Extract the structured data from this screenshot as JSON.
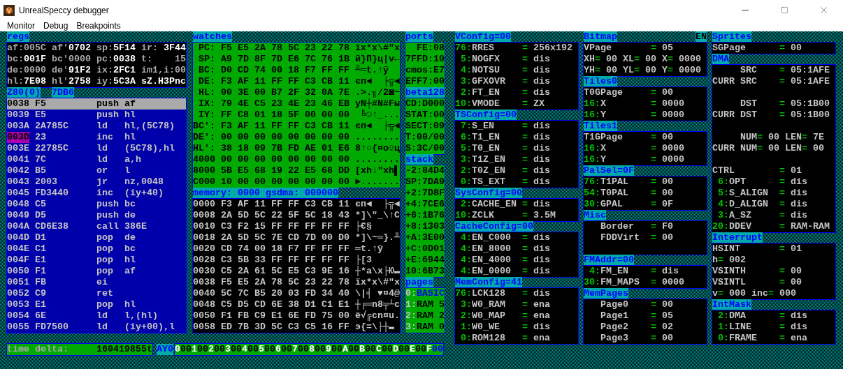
{
  "window": {
    "title": "UnrealSpeccy debugger"
  },
  "menu": [
    "Monitor",
    "Debug",
    "Breakpoints"
  ],
  "regs": {
    "title": "regs",
    "rows": [
      {
        "cells": [
          {
            "name": "af:",
            "value": "005C",
            "bright": false
          },
          {
            "name": "af'",
            "value": "0702",
            "bright": true
          },
          {
            "name": "sp:",
            "value": "5F14",
            "bright": true
          },
          {
            "name": "ir:",
            "value": "3F44",
            "bright": true
          }
        ]
      },
      {
        "cells": [
          {
            "name": "bc:",
            "value": "001F",
            "bright": true
          },
          {
            "name": "bc'",
            "value": "0000",
            "bright": false
          },
          {
            "name": "pc:",
            "value": "0038",
            "bright": true
          },
          {
            "name": "t:",
            "value": "15",
            "bright": false
          }
        ]
      },
      {
        "cells": [
          {
            "name": "de:",
            "value": "0000",
            "bright": false
          },
          {
            "name": "de'",
            "value": "91F2",
            "bright": true
          },
          {
            "name": "ix:",
            "value": "2FC1",
            "bright": true
          },
          {
            "name": "im1,i:",
            "value": "00",
            "bright": false
          }
        ]
      },
      {
        "cells": [
          {
            "name": "hl:",
            "value": "7E08",
            "bright": true
          },
          {
            "name": "hl'",
            "value": "2758",
            "bright": true
          },
          {
            "name": "iy:",
            "value": "5C3A",
            "bright": true
          },
          {
            "value": "sZ.H3Pnc",
            "bright": true
          }
        ]
      }
    ]
  },
  "disasm": {
    "cpu": "Z80(0)",
    "address": "7DB6",
    "rows": [
      {
        "addr": "0038",
        "bytes": "F5",
        "op": "push",
        "args": "af",
        "selected": true,
        "breakpoint": false
      },
      {
        "addr": "0039",
        "bytes": "E5",
        "op": "push",
        "args": "hl",
        "selected": false,
        "breakpoint": false
      },
      {
        "addr": "003A",
        "bytes": "2A785C",
        "op": "ld",
        "args": "hl,(5C78)",
        "selected": false,
        "breakpoint": false
      },
      {
        "addr": "003D",
        "bytes": "23",
        "op": "inc",
        "args": "hl",
        "selected": false,
        "breakpoint": true
      },
      {
        "addr": "003E",
        "bytes": "22785C",
        "op": "ld",
        "args": "(5C78),hl",
        "selected": false,
        "breakpoint": false
      },
      {
        "addr": "0041",
        "bytes": "7C",
        "op": "ld",
        "args": "a,h",
        "selected": false,
        "breakpoint": false
      },
      {
        "addr": "0042",
        "bytes": "B5",
        "op": "or",
        "args": "l",
        "selected": false,
        "breakpoint": false
      },
      {
        "addr": "0043",
        "bytes": "2003",
        "op": "jr",
        "args": "nz,0048",
        "selected": false,
        "breakpoint": false
      },
      {
        "addr": "0045",
        "bytes": "FD3440",
        "op": "inc",
        "args": "(iy+40)",
        "selected": false,
        "breakpoint": false
      },
      {
        "addr": "0048",
        "bytes": "C5",
        "op": "push",
        "args": "bc",
        "selected": false,
        "breakpoint": false
      },
      {
        "addr": "0049",
        "bytes": "D5",
        "op": "push",
        "args": "de",
        "selected": false,
        "breakpoint": false
      },
      {
        "addr": "004A",
        "bytes": "CD6E38",
        "op": "call",
        "args": "386E",
        "selected": false,
        "breakpoint": false
      },
      {
        "addr": "004D",
        "bytes": "D1",
        "op": "pop",
        "args": "de",
        "selected": false,
        "breakpoint": false
      },
      {
        "addr": "004E",
        "bytes": "C1",
        "op": "pop",
        "args": "bc",
        "selected": false,
        "breakpoint": false
      },
      {
        "addr": "004F",
        "bytes": "E1",
        "op": "pop",
        "args": "hl",
        "selected": false,
        "breakpoint": false
      },
      {
        "addr": "0050",
        "bytes": "F1",
        "op": "pop",
        "args": "af",
        "selected": false,
        "breakpoint": false
      },
      {
        "addr": "0051",
        "bytes": "FB",
        "op": "ei",
        "selected": false,
        "breakpoint": false
      },
      {
        "addr": "0052",
        "bytes": "C9",
        "op": "ret",
        "selected": false,
        "breakpoint": false
      },
      {
        "addr": "0053",
        "bytes": "E1",
        "op": "pop",
        "args": "hl",
        "selected": false,
        "breakpoint": false
      },
      {
        "addr": "0054",
        "bytes": "6E",
        "op": "ld",
        "args": "l,(hl)",
        "selected": false,
        "breakpoint": false
      },
      {
        "addr": "0055",
        "bytes": "FD7500",
        "op": "ld",
        "args": "(iy+00),l",
        "selected": false,
        "breakpoint": false
      }
    ]
  },
  "watches": {
    "title": "watches",
    "rows": [
      {
        "label": "PC:",
        "bytes": "F5 E5 2A 78 5C 23 22 78",
        "ascii": "їх*x\\#\"x"
      },
      {
        "label": "SP:",
        "bytes": "A9 7D 8F 7D E6 7C 76 1B",
        "ascii": "й}П}ц|v←"
      },
      {
        "label": "BC:",
        "bytes": "D0 CD 74 00 18 F7 FF FF",
        "ascii": "╨═t.↑ў"
      },
      {
        "label": "DE:",
        "bytes": "F3 AF 11 FF FF C3 CB 11",
        "ascii": "єп◄  ├╦◄"
      },
      {
        "label": "HL:",
        "bytes": "00 3E 00 B7 2F 32 0A 7E",
        "ascii": ".>.╖/2◙~"
      },
      {
        "label": "IX:",
        "bytes": "79 4E C5 23 4E 23 46 EB",
        "ascii": "yN┼#N#Fы"
      },
      {
        "label": "IY:",
        "bytes": "FF C8 01 18 5F 00 00 00",
        "ascii": " ╚☺↑_..."
      },
      {
        "label": "BC':",
        "bytes": "F3 AF 11 FF FF C3 CB 11",
        "ascii": "єп◄  ├╦◄"
      },
      {
        "label": "DE':",
        "bytes": "00 00 00 00 00 00 00 00",
        "ascii": "........"
      },
      {
        "label": "HL':",
        "bytes": "38 18 09 7B FD AE 01 E6",
        "ascii": "8↑○{¤о☺ц"
      },
      {
        "label": "4000",
        "bytes": "00 00 00 00 00 00 00 00",
        "ascii": "........"
      },
      {
        "label": "8000",
        "bytes": "5B E5 68 19 22 E5 68 DD",
        "ascii": "[хh↓\"хh▌"
      },
      {
        "label": "C000",
        "bytes": "10 00 00 00 00 00 00 00",
        "ascii": "►......."
      }
    ]
  },
  "memory": {
    "title": "memory: 0000 gsdma: 000000",
    "rows": [
      {
        "label": "0000",
        "bytes": "F3 AF 11 FF FF C3 CB 11",
        "ascii": "єп◄  ├╦◄"
      },
      {
        "label": "0008",
        "bytes": "2A 5D 5C 22 5F 5C 18 43",
        "ascii": "*]\\\"_\\↑C"
      },
      {
        "label": "0010",
        "bytes": "C3 F2 15 FF FF FF FF FF",
        "ascii": "├Є§"
      },
      {
        "label": "0018",
        "bytes": "2A 5D 5C 7E CD 7D 00 D0",
        "ascii": "*]\\~═}.╨"
      },
      {
        "label": "0020",
        "bytes": "CD 74 00 18 F7 FF FF FF",
        "ascii": "═t.↑ў"
      },
      {
        "label": "0028",
        "bytes": "C3 5B 33 FF FF FF FF FF",
        "ascii": "├[3"
      },
      {
        "label": "0030",
        "bytes": "C5 2A 61 5C E5 C3 9E 16",
        "ascii": "┼*a\\х├Ю▬"
      },
      {
        "label": "0038",
        "bytes": "F5 E5 2A 78 5C 23 22 78",
        "ascii": "їх*x\\#\"x"
      },
      {
        "label": "0040",
        "bytes": "5C 7C B5 20 03 FD 34 40",
        "ascii": "\\|╡ ♥¤4@"
      },
      {
        "label": "0048",
        "bytes": "C5 D5 CD 6E 38 D1 C1 E1",
        "ascii": "┼╒═n8╤┴с"
      },
      {
        "label": "0050",
        "bytes": "F1 FB C9 E1 6E FD 75 00",
        "ascii": "ё√╔сn¤u."
      },
      {
        "label": "0058",
        "bytes": "ED 7B 3D 5C C3 C5 16 FF",
        "ascii": "э{=\\├┼▬"
      }
    ]
  },
  "io": [
    {
      "kind": "ports",
      "title": "ports",
      "lines": [
        "FE:08",
        "7FFD:10",
        "cmos:E7",
        "EFF7:00"
      ]
    },
    {
      "kind": "lines",
      "title": "beta128",
      "lines": [
        "CD:D000",
        "STAT:00",
        "SECT:09",
        "T:00/00",
        "S:3C/00"
      ]
    },
    {
      "kind": "lines",
      "title": "stack",
      "lines": [
        "-2:84D4",
        "SP:7DA9",
        "+2:7D8F",
        "+4:7CE6",
        "+6:1B76",
        "+8:1303",
        "+A:3E00",
        "+C:0D01",
        "+E:6944",
        "10:6B73"
      ]
    },
    {
      "kind": "pages",
      "title": "pages",
      "pages": [
        {
          "index": "0:",
          "name": "BASIC",
          "selected": true
        },
        {
          "index": "1:",
          "name": "RAM 5",
          "selected": false
        },
        {
          "index": "2:",
          "name": "RAM 2",
          "selected": false
        },
        {
          "index": "3:",
          "name": "RAM 0",
          "selected": false
        }
      ]
    }
  ],
  "config_columns": [
    {
      "sections": [
        {
          "title": "VConfig=00",
          "rows": [
            {
              "kind": "field",
              "bits": "76:",
              "name": "RRES",
              "eq": "=",
              "value": "256x192"
            },
            {
              "kind": "field",
              "bits": "5:",
              "name": "NOGFX",
              "eq": "=",
              "value": "dis"
            },
            {
              "kind": "field",
              "bits": "4:",
              "name": "NOTSU",
              "eq": "=",
              "value": "dis"
            },
            {
              "kind": "field",
              "bits": "3:",
              "name": "GFXOVR",
              "eq": "=",
              "value": "dis"
            },
            {
              "kind": "field",
              "bits": "2:",
              "name": "FT_EN",
              "eq": "=",
              "value": "dis"
            },
            {
              "kind": "field",
              "bits": "10:",
              "name": "VMODE",
              "eq": "=",
              "value": "ZX"
            }
          ]
        },
        {
          "title": "TSConfig=00",
          "rows": [
            {
              "kind": "field",
              "bits": "7:",
              "name": "S_EN",
              "eq": "=",
              "value": "dis"
            },
            {
              "kind": "field",
              "bits": "6:",
              "name": "T1_EN",
              "eq": "=",
              "value": "dis"
            },
            {
              "kind": "field",
              "bits": "5:",
              "name": "T0_EN",
              "eq": "=",
              "value": "dis"
            },
            {
              "kind": "field",
              "bits": "3:",
              "name": "T1Z_EN",
              "eq": "=",
              "value": "dis"
            },
            {
              "kind": "field",
              "bits": "2:",
              "name": "T0Z_EN",
              "eq": "=",
              "value": "dis"
            },
            {
              "kind": "field",
              "bits": "0:",
              "name": "TS_EXT",
              "eq": "=",
              "value": "dis"
            }
          ]
        },
        {
          "title": "SysConfig=00",
          "rows": [
            {
              "kind": "field",
              "bits": "2:",
              "name": "CACHE_EN",
              "eq": "=",
              "value": "dis"
            },
            {
              "kind": "field",
              "bits": "10:",
              "name": "ZCLK",
              "eq": "=",
              "value": "3.5M"
            }
          ]
        },
        {
          "title": "CacheConfig=00",
          "rows": [
            {
              "kind": "field",
              "bits": "4:",
              "name": "EN_C000",
              "eq": "=",
              "value": "dis"
            },
            {
              "kind": "field",
              "bits": "4:",
              "name": "EN_8000",
              "eq": "=",
              "value": "dis"
            },
            {
              "kind": "field",
              "bits": "4:",
              "name": "EN_4000",
              "eq": "=",
              "value": "dis"
            },
            {
              "kind": "field",
              "bits": "4:",
              "name": "EN_0000",
              "eq": "=",
              "value": "dis"
            }
          ]
        },
        {
          "title": "MemConfig=41",
          "rows": [
            {
              "kind": "field",
              "bits": "76:",
              "name": "LCK128",
              "eq": "=",
              "value": "dis"
            },
            {
              "kind": "field",
              "bits": "3:",
              "name": "W0_RAM",
              "eq": "=",
              "value": "ena"
            },
            {
              "kind": "field",
              "bits": "2:",
              "name": "W0_MAP",
              "eq": "=",
              "value": "ena"
            },
            {
              "kind": "field",
              "bits": "1:",
              "name": "W0_WE",
              "eq": "=",
              "value": "dis"
            },
            {
              "kind": "field",
              "bits": "0:",
              "name": "ROM128",
              "eq": "=",
              "value": "ena"
            }
          ]
        }
      ]
    },
    {
      "sections": [
        {
          "title": "Bitmap",
          "badge": "EN",
          "rows": [
            {
              "kind": "field",
              "name": "VPage",
              "eq": "=",
              "value": "05"
            },
            {
              "kind": "pairs",
              "items": [
                {
                  "name": "XH",
                  "eq": "=",
                  "value": "00"
                },
                {
                  "name": "XL",
                  "eq": "=",
                  "value": "00"
                },
                {
                  "name": "X",
                  "eq": "=",
                  "value": "0000"
                }
              ]
            },
            {
              "kind": "pairs",
              "items": [
                {
                  "name": "YH",
                  "eq": "=",
                  "value": "00"
                },
                {
                  "name": "YL",
                  "eq": "=",
                  "value": "00"
                },
                {
                  "name": "Y",
                  "eq": "=",
                  "value": "0000"
                }
              ]
            }
          ]
        },
        {
          "title": "Tiles0",
          "rows": [
            {
              "kind": "field",
              "name": "T0GPage",
              "eq": "=",
              "value": "00"
            },
            {
              "kind": "field",
              "bits": "16:",
              "name": "X",
              "eq": "=",
              "value": "0000"
            },
            {
              "kind": "field",
              "bits": "16:",
              "name": "Y",
              "eq": "=",
              "value": "0000"
            }
          ]
        },
        {
          "title": "Tiles1",
          "rows": [
            {
              "kind": "field",
              "name": "T1GPage",
              "eq": "=",
              "value": "00"
            },
            {
              "kind": "field",
              "bits": "16:",
              "name": "X",
              "eq": "=",
              "value": "0000"
            },
            {
              "kind": "field",
              "bits": "16:",
              "name": "Y",
              "eq": "=",
              "value": "0000"
            }
          ]
        },
        {
          "title": "PalSel=0F",
          "rows": [
            {
              "kind": "field",
              "bits": "76:",
              "name": "T1PAL",
              "eq": "=",
              "value": "00"
            },
            {
              "kind": "field",
              "bits": "54:",
              "name": "T0PAL",
              "eq": "=",
              "value": "00"
            },
            {
              "kind": "field",
              "bits": "30:",
              "name": "GPAL",
              "eq": "=",
              "value": "0F"
            }
          ]
        },
        {
          "title": "Misc",
          "rows": [
            {
              "kind": "indented",
              "name": "Border",
              "eq": "=",
              "value": "F0"
            },
            {
              "kind": "indented",
              "name": "FDDVirt",
              "eq": "=",
              "value": "00"
            },
            {
              "kind": "blank"
            }
          ]
        },
        {
          "title": "FMAddr=00",
          "rows": [
            {
              "kind": "field",
              "bits": "4:",
              "name": "FM_EN",
              "eq": "=",
              "value": "dis"
            },
            {
              "kind": "field",
              "bits": "30:",
              "name": "FM_MAPS",
              "eq": "=",
              "value": "0000"
            }
          ]
        },
        {
          "title": "MemPages",
          "rows": [
            {
              "kind": "indented",
              "name": "Page0",
              "eq": "=",
              "value": "00"
            },
            {
              "kind": "indented",
              "name": "Page1",
              "eq": "=",
              "value": "05"
            },
            {
              "kind": "indented",
              "name": "Page2",
              "eq": "=",
              "value": "02"
            },
            {
              "kind": "indented",
              "name": "Page3",
              "eq": "=",
              "value": "00"
            }
          ]
        }
      ]
    },
    {
      "sections": [
        {
          "title": "Sprites",
          "rows": [
            {
              "kind": "field",
              "name": "SGPage",
              "eq": "=",
              "value": "00"
            }
          ]
        },
        {
          "title": "DMA",
          "rows": [
            {
              "kind": "aligned",
              "name": "SRC",
              "eq": "=",
              "value": "05:1AFE"
            },
            {
              "kind": "aligned",
              "prefix": "CURR",
              "name": "SRC",
              "eq": "=",
              "value": "05:1AFE"
            },
            {
              "kind": "blank"
            },
            {
              "kind": "aligned",
              "name": "DST",
              "eq": "=",
              "value": "05:1B00"
            },
            {
              "kind": "aligned",
              "prefix": "CURR",
              "name": "DST",
              "eq": "=",
              "value": "05:1B00"
            },
            {
              "kind": "blank"
            },
            {
              "kind": "aligned_pairs",
              "items": [
                {
                  "name": "NUM",
                  "eq": "=",
                  "value": "00"
                },
                {
                  "name": "LEN",
                  "eq": "=",
                  "value": "7E"
                }
              ]
            },
            {
              "kind": "aligned_pairs",
              "prefix": "CURR",
              "items": [
                {
                  "name": "NUM",
                  "eq": "=",
                  "value": "00"
                },
                {
                  "name": "LEN",
                  "eq": "=",
                  "value": "00"
                }
              ]
            },
            {
              "kind": "blank"
            },
            {
              "kind": "field",
              "name": "CTRL",
              "eq": "=",
              "value": "01"
            },
            {
              "kind": "field",
              "bits": "6:",
              "name": "OPT",
              "eq": "=",
              "value": "dis"
            },
            {
              "kind": "field",
              "bits": "5:",
              "name": "S_ALIGN",
              "eq": "=",
              "value": "dis"
            },
            {
              "kind": "field",
              "bits": "4:",
              "name": "D_ALIGN",
              "eq": "=",
              "value": "dis"
            },
            {
              "kind": "field",
              "bits": "3:",
              "name": "A_SZ",
              "eq": "=",
              "value": "dis"
            },
            {
              "kind": "field",
              "bits": "20:",
              "name": "DDEV",
              "eq": "=",
              "value": "RAM-RAM"
            }
          ]
        },
        {
          "title": "Interrupt",
          "rows": [
            {
              "kind": "field",
              "name": "HSINT",
              "eq": "=",
              "value": "01"
            },
            {
              "kind": "pairs",
              "items": [
                {
                  "name": "h",
                  "eq": "=",
                  "value": "002"
                }
              ]
            },
            {
              "kind": "field",
              "name": "VSINTH",
              "eq": "=",
              "value": "00"
            },
            {
              "kind": "field",
              "name": "VSINTL",
              "eq": "=",
              "value": "00"
            },
            {
              "kind": "pairs",
              "items": [
                {
                  "name": "v",
                  "eq": "=",
                  "value": "000"
                },
                {
                  "name": "inc",
                  "eq": "=",
                  "value": "000"
                }
              ]
            }
          ]
        },
        {
          "title": "IntMask",
          "rows": [
            {
              "kind": "field",
              "bits": "2:",
              "name": "DMA",
              "eq": "=",
              "value": "dis"
            },
            {
              "kind": "field",
              "bits": "1:",
              "name": "LINE",
              "eq": "=",
              "value": "dis"
            },
            {
              "kind": "field",
              "bits": "0:",
              "name": "FRAME",
              "eq": "=",
              "value": "ena"
            }
          ]
        }
      ]
    }
  ],
  "time_delta": {
    "label": "time delta:",
    "value": "160419855t"
  },
  "ay": {
    "label": "AY0",
    "registers": [
      {
        "index": "0",
        "value": "00",
        "selected": false
      },
      {
        "index": "1",
        "value": "00",
        "selected": false
      },
      {
        "index": "2",
        "value": "00",
        "selected": false
      },
      {
        "index": "3",
        "value": "00",
        "selected": false
      },
      {
        "index": "4",
        "value": "00",
        "selected": false
      },
      {
        "index": "5",
        "value": "00",
        "selected": false
      },
      {
        "index": "6",
        "value": "00",
        "selected": false
      },
      {
        "index": "7",
        "value": "00",
        "selected": false
      },
      {
        "index": "8",
        "value": "00",
        "selected": false
      },
      {
        "index": "9",
        "value": "00",
        "selected": false
      },
      {
        "index": "A",
        "value": "00",
        "selected": false
      },
      {
        "index": "B",
        "value": "00",
        "selected": false
      },
      {
        "index": "C",
        "value": "00",
        "selected": false
      },
      {
        "index": "D",
        "value": "00",
        "selected": false
      },
      {
        "index": "E",
        "value": "00",
        "selected": false
      },
      {
        "index": "F",
        "value": "00",
        "selected": true
      }
    ]
  }
}
